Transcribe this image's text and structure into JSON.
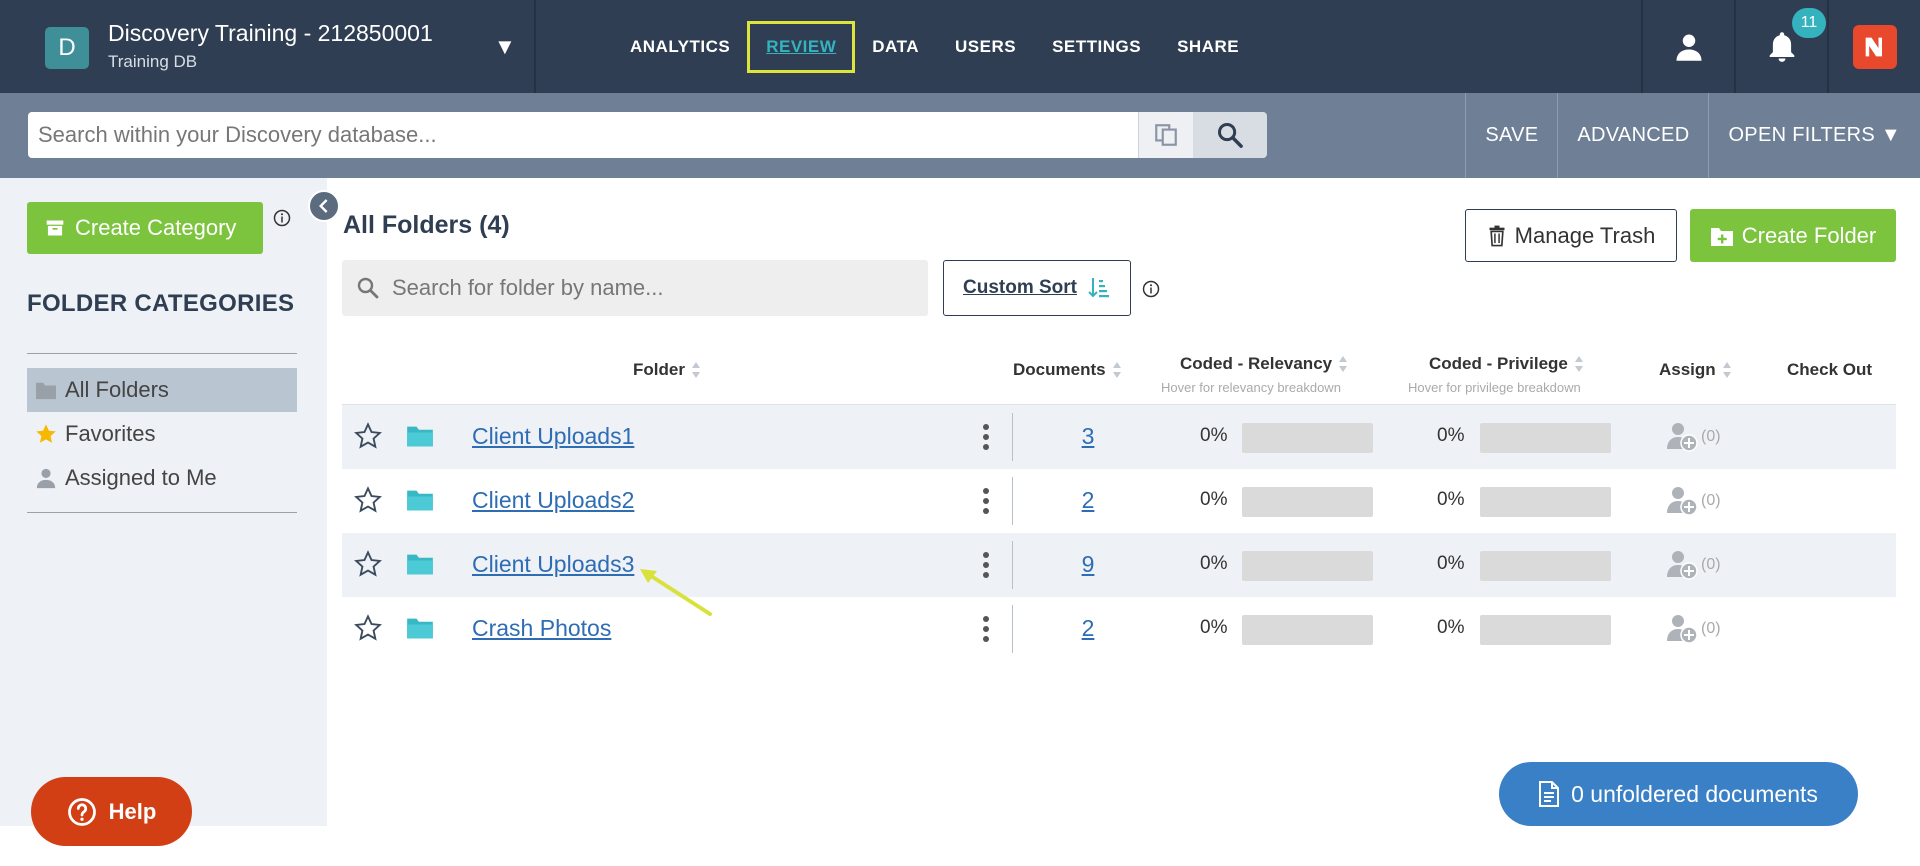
{
  "header": {
    "avatar_letter": "D",
    "title": "Discovery Training - 212850001",
    "subtitle": "Training DB",
    "notification_count": "11"
  },
  "nav": {
    "items": [
      {
        "label": "ANALYTICS",
        "active": false
      },
      {
        "label": "REVIEW",
        "active": true
      },
      {
        "label": "DATA",
        "active": false
      },
      {
        "label": "USERS",
        "active": false
      },
      {
        "label": "SETTINGS",
        "active": false
      },
      {
        "label": "SHARE",
        "active": false
      }
    ]
  },
  "search": {
    "placeholder": "Search within your Discovery database...",
    "save_label": "SAVE",
    "advanced_label": "ADVANCED",
    "open_filters_label": "OPEN FILTERS ▼"
  },
  "sidebar": {
    "create_category_label": "Create Category",
    "heading": "FOLDER CATEGORIES",
    "items": [
      {
        "label": "All Folders",
        "icon": "folder-icon",
        "selected": true
      },
      {
        "label": "Favorites",
        "icon": "star-icon",
        "selected": false
      },
      {
        "label": "Assigned to Me",
        "icon": "user-icon",
        "selected": false
      }
    ],
    "help_label": "Help"
  },
  "main": {
    "title": "All Folders (4)",
    "folder_search_placeholder": "Search for folder by name...",
    "custom_sort_label": "Custom Sort",
    "manage_trash_label": "Manage Trash",
    "create_folder_label": "Create Folder",
    "columns": {
      "folder": "Folder",
      "documents": "Documents",
      "coded_relevancy": "Coded - Relevancy",
      "coded_relevancy_hint": "Hover for relevancy breakdown",
      "coded_privilege": "Coded - Privilege",
      "coded_privilege_hint": "Hover for privilege breakdown",
      "assign": "Assign",
      "check_out": "Check Out"
    },
    "rows": [
      {
        "name": "Client Uploads1",
        "documents": "3",
        "relevancy": "0%",
        "privilege": "0%",
        "assign_count": "(0)"
      },
      {
        "name": "Client Uploads2",
        "documents": "2",
        "relevancy": "0%",
        "privilege": "0%",
        "assign_count": "(0)"
      },
      {
        "name": "Client Uploads3",
        "documents": "9",
        "relevancy": "0%",
        "privilege": "0%",
        "assign_count": "(0)"
      },
      {
        "name": "Crash Photos",
        "documents": "2",
        "relevancy": "0%",
        "privilege": "0%",
        "assign_count": "(0)"
      }
    ],
    "unfoldered_label": "0 unfoldered documents"
  },
  "colors": {
    "topbar": "#2f3e52",
    "searchbar": "#6e7f96",
    "accent_teal": "#34b3bf",
    "green": "#7cc33e",
    "link_blue": "#2e6db4",
    "help_red": "#d23f15",
    "highlight_yellow": "#dde43a"
  }
}
